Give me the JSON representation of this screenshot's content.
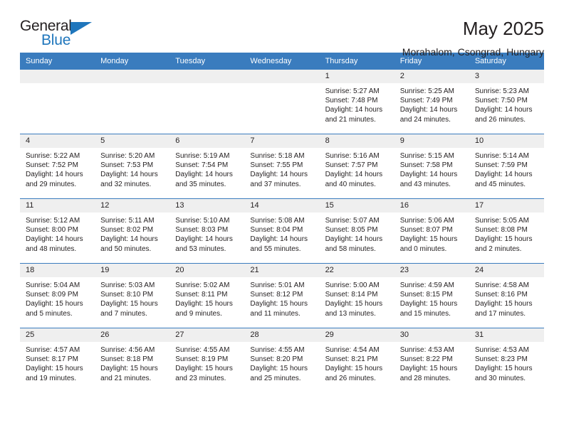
{
  "brand": {
    "name_part1": "General",
    "name_part2": "Blue",
    "accent_color": "#1f76bc"
  },
  "header": {
    "title": "May 2025",
    "subtitle": "Morahalom, Csongrad, Hungary"
  },
  "calendar": {
    "header_color": "#3a7cbe",
    "daynum_bg": "#efefef",
    "weekday_headers": [
      "Sunday",
      "Monday",
      "Tuesday",
      "Wednesday",
      "Thursday",
      "Friday",
      "Saturday"
    ],
    "weeks": [
      [
        {
          "day": "",
          "empty": true,
          "sunrise": "",
          "sunset": "",
          "daylight_line1": "",
          "daylight_line2": ""
        },
        {
          "day": "",
          "empty": true,
          "sunrise": "",
          "sunset": "",
          "daylight_line1": "",
          "daylight_line2": ""
        },
        {
          "day": "",
          "empty": true,
          "sunrise": "",
          "sunset": "",
          "daylight_line1": "",
          "daylight_line2": ""
        },
        {
          "day": "",
          "empty": true,
          "sunrise": "",
          "sunset": "",
          "daylight_line1": "",
          "daylight_line2": ""
        },
        {
          "day": "1",
          "empty": false,
          "sunrise": "Sunrise: 5:27 AM",
          "sunset": "Sunset: 7:48 PM",
          "daylight_line1": "Daylight: 14 hours",
          "daylight_line2": "and 21 minutes."
        },
        {
          "day": "2",
          "empty": false,
          "sunrise": "Sunrise: 5:25 AM",
          "sunset": "Sunset: 7:49 PM",
          "daylight_line1": "Daylight: 14 hours",
          "daylight_line2": "and 24 minutes."
        },
        {
          "day": "3",
          "empty": false,
          "sunrise": "Sunrise: 5:23 AM",
          "sunset": "Sunset: 7:50 PM",
          "daylight_line1": "Daylight: 14 hours",
          "daylight_line2": "and 26 minutes."
        }
      ],
      [
        {
          "day": "4",
          "empty": false,
          "sunrise": "Sunrise: 5:22 AM",
          "sunset": "Sunset: 7:52 PM",
          "daylight_line1": "Daylight: 14 hours",
          "daylight_line2": "and 29 minutes."
        },
        {
          "day": "5",
          "empty": false,
          "sunrise": "Sunrise: 5:20 AM",
          "sunset": "Sunset: 7:53 PM",
          "daylight_line1": "Daylight: 14 hours",
          "daylight_line2": "and 32 minutes."
        },
        {
          "day": "6",
          "empty": false,
          "sunrise": "Sunrise: 5:19 AM",
          "sunset": "Sunset: 7:54 PM",
          "daylight_line1": "Daylight: 14 hours",
          "daylight_line2": "and 35 minutes."
        },
        {
          "day": "7",
          "empty": false,
          "sunrise": "Sunrise: 5:18 AM",
          "sunset": "Sunset: 7:55 PM",
          "daylight_line1": "Daylight: 14 hours",
          "daylight_line2": "and 37 minutes."
        },
        {
          "day": "8",
          "empty": false,
          "sunrise": "Sunrise: 5:16 AM",
          "sunset": "Sunset: 7:57 PM",
          "daylight_line1": "Daylight: 14 hours",
          "daylight_line2": "and 40 minutes."
        },
        {
          "day": "9",
          "empty": false,
          "sunrise": "Sunrise: 5:15 AM",
          "sunset": "Sunset: 7:58 PM",
          "daylight_line1": "Daylight: 14 hours",
          "daylight_line2": "and 43 minutes."
        },
        {
          "day": "10",
          "empty": false,
          "sunrise": "Sunrise: 5:14 AM",
          "sunset": "Sunset: 7:59 PM",
          "daylight_line1": "Daylight: 14 hours",
          "daylight_line2": "and 45 minutes."
        }
      ],
      [
        {
          "day": "11",
          "empty": false,
          "sunrise": "Sunrise: 5:12 AM",
          "sunset": "Sunset: 8:00 PM",
          "daylight_line1": "Daylight: 14 hours",
          "daylight_line2": "and 48 minutes."
        },
        {
          "day": "12",
          "empty": false,
          "sunrise": "Sunrise: 5:11 AM",
          "sunset": "Sunset: 8:02 PM",
          "daylight_line1": "Daylight: 14 hours",
          "daylight_line2": "and 50 minutes."
        },
        {
          "day": "13",
          "empty": false,
          "sunrise": "Sunrise: 5:10 AM",
          "sunset": "Sunset: 8:03 PM",
          "daylight_line1": "Daylight: 14 hours",
          "daylight_line2": "and 53 minutes."
        },
        {
          "day": "14",
          "empty": false,
          "sunrise": "Sunrise: 5:08 AM",
          "sunset": "Sunset: 8:04 PM",
          "daylight_line1": "Daylight: 14 hours",
          "daylight_line2": "and 55 minutes."
        },
        {
          "day": "15",
          "empty": false,
          "sunrise": "Sunrise: 5:07 AM",
          "sunset": "Sunset: 8:05 PM",
          "daylight_line1": "Daylight: 14 hours",
          "daylight_line2": "and 58 minutes."
        },
        {
          "day": "16",
          "empty": false,
          "sunrise": "Sunrise: 5:06 AM",
          "sunset": "Sunset: 8:07 PM",
          "daylight_line1": "Daylight: 15 hours",
          "daylight_line2": "and 0 minutes."
        },
        {
          "day": "17",
          "empty": false,
          "sunrise": "Sunrise: 5:05 AM",
          "sunset": "Sunset: 8:08 PM",
          "daylight_line1": "Daylight: 15 hours",
          "daylight_line2": "and 2 minutes."
        }
      ],
      [
        {
          "day": "18",
          "empty": false,
          "sunrise": "Sunrise: 5:04 AM",
          "sunset": "Sunset: 8:09 PM",
          "daylight_line1": "Daylight: 15 hours",
          "daylight_line2": "and 5 minutes."
        },
        {
          "day": "19",
          "empty": false,
          "sunrise": "Sunrise: 5:03 AM",
          "sunset": "Sunset: 8:10 PM",
          "daylight_line1": "Daylight: 15 hours",
          "daylight_line2": "and 7 minutes."
        },
        {
          "day": "20",
          "empty": false,
          "sunrise": "Sunrise: 5:02 AM",
          "sunset": "Sunset: 8:11 PM",
          "daylight_line1": "Daylight: 15 hours",
          "daylight_line2": "and 9 minutes."
        },
        {
          "day": "21",
          "empty": false,
          "sunrise": "Sunrise: 5:01 AM",
          "sunset": "Sunset: 8:12 PM",
          "daylight_line1": "Daylight: 15 hours",
          "daylight_line2": "and 11 minutes."
        },
        {
          "day": "22",
          "empty": false,
          "sunrise": "Sunrise: 5:00 AM",
          "sunset": "Sunset: 8:14 PM",
          "daylight_line1": "Daylight: 15 hours",
          "daylight_line2": "and 13 minutes."
        },
        {
          "day": "23",
          "empty": false,
          "sunrise": "Sunrise: 4:59 AM",
          "sunset": "Sunset: 8:15 PM",
          "daylight_line1": "Daylight: 15 hours",
          "daylight_line2": "and 15 minutes."
        },
        {
          "day": "24",
          "empty": false,
          "sunrise": "Sunrise: 4:58 AM",
          "sunset": "Sunset: 8:16 PM",
          "daylight_line1": "Daylight: 15 hours",
          "daylight_line2": "and 17 minutes."
        }
      ],
      [
        {
          "day": "25",
          "empty": false,
          "sunrise": "Sunrise: 4:57 AM",
          "sunset": "Sunset: 8:17 PM",
          "daylight_line1": "Daylight: 15 hours",
          "daylight_line2": "and 19 minutes."
        },
        {
          "day": "26",
          "empty": false,
          "sunrise": "Sunrise: 4:56 AM",
          "sunset": "Sunset: 8:18 PM",
          "daylight_line1": "Daylight: 15 hours",
          "daylight_line2": "and 21 minutes."
        },
        {
          "day": "27",
          "empty": false,
          "sunrise": "Sunrise: 4:55 AM",
          "sunset": "Sunset: 8:19 PM",
          "daylight_line1": "Daylight: 15 hours",
          "daylight_line2": "and 23 minutes."
        },
        {
          "day": "28",
          "empty": false,
          "sunrise": "Sunrise: 4:55 AM",
          "sunset": "Sunset: 8:20 PM",
          "daylight_line1": "Daylight: 15 hours",
          "daylight_line2": "and 25 minutes."
        },
        {
          "day": "29",
          "empty": false,
          "sunrise": "Sunrise: 4:54 AM",
          "sunset": "Sunset: 8:21 PM",
          "daylight_line1": "Daylight: 15 hours",
          "daylight_line2": "and 26 minutes."
        },
        {
          "day": "30",
          "empty": false,
          "sunrise": "Sunrise: 4:53 AM",
          "sunset": "Sunset: 8:22 PM",
          "daylight_line1": "Daylight: 15 hours",
          "daylight_line2": "and 28 minutes."
        },
        {
          "day": "31",
          "empty": false,
          "sunrise": "Sunrise: 4:53 AM",
          "sunset": "Sunset: 8:23 PM",
          "daylight_line1": "Daylight: 15 hours",
          "daylight_line2": "and 30 minutes."
        }
      ]
    ]
  }
}
